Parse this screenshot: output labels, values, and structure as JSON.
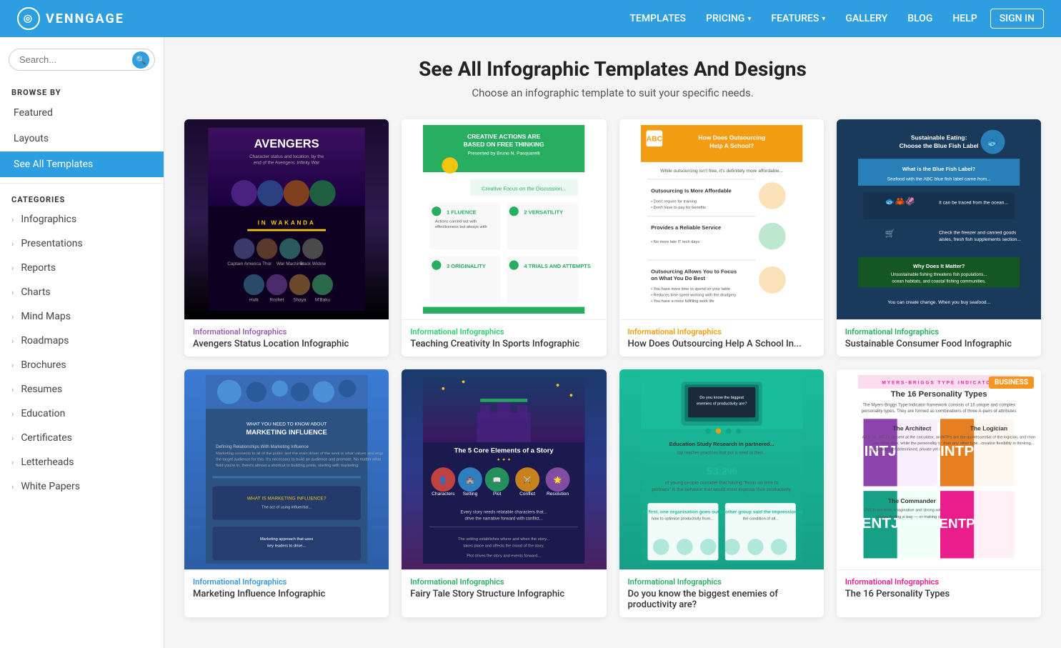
{
  "nav": {
    "logo_text": "VENNGAGE",
    "links": [
      {
        "label": "TEMPLATES",
        "has_chevron": false
      },
      {
        "label": "PRICING",
        "has_chevron": true
      },
      {
        "label": "FEATURES",
        "has_chevron": true
      },
      {
        "label": "GALLERY",
        "has_chevron": false
      },
      {
        "label": "BLOG",
        "has_chevron": false
      },
      {
        "label": "HELP",
        "has_chevron": false
      },
      {
        "label": "SIGN IN",
        "has_chevron": false,
        "is_signin": true
      }
    ]
  },
  "sidebar": {
    "search_placeholder": "Search...",
    "browse_by_label": "BROWSE BY",
    "browse_items": [
      {
        "label": "Featured",
        "active": false
      },
      {
        "label": "Layouts",
        "active": false
      },
      {
        "label": "See All Templates",
        "active": true
      }
    ],
    "categories_label": "CATEGORIES",
    "categories": [
      {
        "label": "Infographics"
      },
      {
        "label": "Presentations"
      },
      {
        "label": "Reports"
      },
      {
        "label": "Charts"
      },
      {
        "label": "Mind Maps"
      },
      {
        "label": "Roadmaps"
      },
      {
        "label": "Brochures"
      },
      {
        "label": "Resumes"
      },
      {
        "label": "Education"
      },
      {
        "label": "Certificates"
      },
      {
        "label": "Letterheads"
      },
      {
        "label": "White Papers"
      }
    ]
  },
  "page": {
    "title": "See All Infographic Templates And Designs",
    "subtitle": "Choose an infographic template to suit your specific needs."
  },
  "templates": [
    {
      "id": 1,
      "name": "Avengers Status Location Infographic",
      "category": "Informational Infographics",
      "category_color": "#9b59b6",
      "badge": null,
      "bg": "avengers"
    },
    {
      "id": 2,
      "name": "Teaching Creativity In Sports Infographic",
      "category": "Informational Infographics",
      "category_color": "#2ecc71",
      "badge": null,
      "bg": "creativity"
    },
    {
      "id": 3,
      "name": "How Does Outsourcing Help A School In...",
      "category": "Informational Infographics",
      "category_color": "#f39c12",
      "badge": null,
      "bg": "outsourcing"
    },
    {
      "id": 4,
      "name": "Sustainable Consumer Food Infographic",
      "category": "Informational Infographics",
      "category_color": "#27ae60",
      "badge": null,
      "bg": "sustainable"
    },
    {
      "id": 5,
      "name": "Marketing Influence Infographic",
      "category": "Informational Infographics",
      "category_color": "#3498db",
      "badge": null,
      "bg": "marketing"
    },
    {
      "id": 6,
      "name": "Fairy Tale Story Structure Infographic",
      "category": "Informational Infographics",
      "category_color": "#27ae60",
      "badge": null,
      "bg": "fairytale"
    },
    {
      "id": 7,
      "name": "Do you know the biggest enemies of productivity are?",
      "category": "Informational Infographics",
      "category_color": "#27ae60",
      "badge": null,
      "bg": "productivity"
    },
    {
      "id": 8,
      "name": "The 16 Personality Types",
      "category": "Informational Infographics",
      "category_color": "#e91e8c",
      "badge": "BUSINESS",
      "bg": "personality"
    }
  ]
}
